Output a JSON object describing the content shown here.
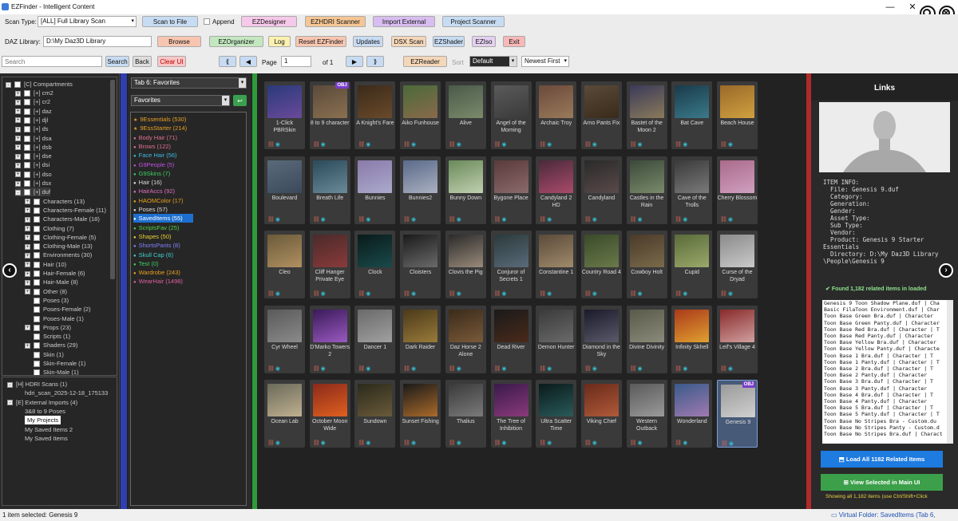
{
  "window": {
    "title": "EZFinder - Intelligent Content",
    "min": "—",
    "close": "✕"
  },
  "toolbar": {
    "scan_type_label": "Scan Type:",
    "scan_type_value": "[ALL] Full Library Scan",
    "scan_to_file": "Scan to File",
    "append": "Append",
    "ezdesigner": "EZDesigner",
    "ezhdri": "EZHDRI Scanner",
    "import_external": "Import External",
    "project_scanner": "Project Scanner",
    "daz_library_label": "DAZ Library:",
    "daz_library_value": "D:\\My Daz3D Library",
    "browse": "Browse",
    "ezorganizer": "EZOrganizer",
    "log": "Log",
    "reset": "Reset EZFinder",
    "updates": "Updates",
    "dsx_scan": "DSX Scan",
    "ezshader": "EZShader",
    "eziso": "EZIso",
    "exit": "Exit",
    "search_placeholder": "Search",
    "search_btn": "Search",
    "back_btn": "Back",
    "clear_ui": "Clear UI",
    "first": "⟪",
    "prev": "◀",
    "page_label": "Page",
    "page_value": "1",
    "of_label": "of 1",
    "next": "▶",
    "last": "⟫",
    "ezreader": "EZReader",
    "sort_label": "Sort",
    "sort_value": "Default",
    "order_value": "Newest First"
  },
  "tree": {
    "root": "[C] Compartments",
    "items": [
      {
        "label": "[+] cm2",
        "level": 1,
        "pm": "+"
      },
      {
        "label": "[+] cr2",
        "level": 1,
        "pm": "+"
      },
      {
        "label": "[+] daz",
        "level": 1,
        "pm": "+"
      },
      {
        "label": "[+] djl",
        "level": 1,
        "pm": "+"
      },
      {
        "label": "[+] ds",
        "level": 1,
        "pm": "+"
      },
      {
        "label": "[+] dsa",
        "level": 1,
        "pm": "+"
      },
      {
        "label": "[+] dsb",
        "level": 1,
        "pm": "+"
      },
      {
        "label": "[+] dse",
        "level": 1,
        "pm": "+"
      },
      {
        "label": "[+] dsi",
        "level": 1,
        "pm": "+"
      },
      {
        "label": "[+] dso",
        "level": 1,
        "pm": "+"
      },
      {
        "label": "[+] dsx",
        "level": 1,
        "pm": "+"
      },
      {
        "label": "[+] duf",
        "level": 1,
        "pm": "-"
      },
      {
        "label": "Characters (13)",
        "level": 2,
        "pm": "+"
      },
      {
        "label": "Characters-Female (11)",
        "level": 2,
        "pm": "+"
      },
      {
        "label": "Characters-Male (18)",
        "level": 2,
        "pm": "+"
      },
      {
        "label": "Clothing (7)",
        "level": 2,
        "pm": "+"
      },
      {
        "label": "Clothing-Female (5)",
        "level": 2,
        "pm": "+"
      },
      {
        "label": "Clothing-Male (13)",
        "level": 2,
        "pm": "+"
      },
      {
        "label": "Environments (30)",
        "level": 2,
        "pm": "+"
      },
      {
        "label": "Hair (10)",
        "level": 2,
        "pm": "+"
      },
      {
        "label": "Hair-Female (6)",
        "level": 2,
        "pm": "+"
      },
      {
        "label": "Hair-Male (8)",
        "level": 2,
        "pm": "+"
      },
      {
        "label": "Other (8)",
        "level": 2,
        "pm": "+"
      },
      {
        "label": "Poses (3)",
        "level": 2,
        "pm": ""
      },
      {
        "label": "Poses-Female (2)",
        "level": 2,
        "pm": ""
      },
      {
        "label": "Poses-Male (1)",
        "level": 2,
        "pm": ""
      },
      {
        "label": "Props (23)",
        "level": 2,
        "pm": "+"
      },
      {
        "label": "Scripts (1)",
        "level": 2,
        "pm": ""
      },
      {
        "label": "Shaders (29)",
        "level": 2,
        "pm": "+"
      },
      {
        "label": "Skin (1)",
        "level": 2,
        "pm": ""
      },
      {
        "label": "Skin-Female (1)",
        "level": 2,
        "pm": ""
      },
      {
        "label": "Skin-Male (1)",
        "level": 2,
        "pm": ""
      }
    ]
  },
  "tree2": {
    "items": [
      {
        "label": "[H] HDRI Scans (1)",
        "level": 0,
        "pm": "-"
      },
      {
        "label": "hdri_scan_2025-12-18_175133",
        "level": 1,
        "pm": ""
      },
      {
        "label": "[E] External Imports (4)",
        "level": 0,
        "pm": "-"
      },
      {
        "label": "3&8 to 9 Poses",
        "level": 1,
        "pm": ""
      },
      {
        "label": "My Projects",
        "level": 1,
        "pm": "",
        "sel": true
      },
      {
        "label": "My Saved Items 2",
        "level": 1,
        "pm": ""
      },
      {
        "label": "My Saved Items",
        "level": 1,
        "pm": ""
      }
    ]
  },
  "favorites": {
    "tab_value": "Tab 6: Favorites",
    "list_value": "Favorites",
    "items": [
      {
        "label": "9Essentials (530)",
        "icon": "★",
        "color": "#e8a020"
      },
      {
        "label": "9EssStarter (214)",
        "icon": "★",
        "color": "#e8a020"
      },
      {
        "label": "Body Hair (71)",
        "icon": "●",
        "color": "#e07090"
      },
      {
        "label": "Brows (122)",
        "icon": "●",
        "color": "#e07090"
      },
      {
        "label": "Face Hair (56)",
        "icon": "●",
        "color": "#40b8e0"
      },
      {
        "label": "G9People (5)",
        "icon": "●",
        "color": "#c050e0"
      },
      {
        "label": "G9Skins (7)",
        "icon": "●",
        "color": "#40d060"
      },
      {
        "label": "Hair (16)",
        "icon": "●",
        "color": "#dddddd"
      },
      {
        "label": "HairAccs (92)",
        "icon": "●",
        "color": "#e070c0"
      },
      {
        "label": "HAOMColor (17)",
        "icon": "●",
        "color": "#e8a020"
      },
      {
        "label": "Poses (57)",
        "icon": "●",
        "color": "#dddddd"
      },
      {
        "label": "SavedItems (55)",
        "icon": "●",
        "color": "#ffffff",
        "sel": true
      },
      {
        "label": "ScriptsFav (25)",
        "icon": "●",
        "color": "#50d040"
      },
      {
        "label": "Shapes (50)",
        "icon": "●",
        "color": "#e8d030"
      },
      {
        "label": "ShortsPants (8)",
        "icon": "●",
        "color": "#8080ff"
      },
      {
        "label": "Skull Cap (6)",
        "icon": "●",
        "color": "#40d0d0"
      },
      {
        "label": "Test (0)",
        "icon": "●",
        "color": "#40d060"
      },
      {
        "label": "Wardrobe (243)",
        "icon": "●",
        "color": "#e8a020"
      },
      {
        "label": "WearHair (1498)",
        "icon": "●",
        "color": "#e060a0"
      }
    ]
  },
  "tiles": [
    {
      "name": "1-Click PBRSkin",
      "c1": "#2a3a7a",
      "c2": "#6a4a9a"
    },
    {
      "name": "8 to 9 character",
      "c1": "#5a4a3a",
      "c2": "#8a7050",
      "obj": true
    },
    {
      "name": "A Knight's Fare",
      "c1": "#3a2a1a",
      "c2": "#6a4a2a"
    },
    {
      "name": "Aiko Funhouse",
      "c1": "#4a6a3a",
      "c2": "#8a6a4a"
    },
    {
      "name": "Alive",
      "c1": "#4a5a4a",
      "c2": "#7a8a6a"
    },
    {
      "name": "Angel of the Morning",
      "c1": "#5a5a5a",
      "c2": "#3a3a3a"
    },
    {
      "name": "Archaic Troy",
      "c1": "#6a4a3a",
      "c2": "#9a7a5a"
    },
    {
      "name": "Arno Pants Fix",
      "c1": "#5a4a3a",
      "c2": "#3a2a1a"
    },
    {
      "name": "Bastet of the Moon 2",
      "c1": "#3a3a5a",
      "c2": "#8a7a5a"
    },
    {
      "name": "Bat Cave",
      "c1": "#1a3a4a",
      "c2": "#3a7a8a"
    },
    {
      "name": "Beach House",
      "c1": "#9a6a2a",
      "c2": "#d0a040"
    },
    {
      "name": "Boulevard",
      "c1": "#5a6a7a",
      "c2": "#3a4a5a"
    },
    {
      "name": "Breath Life",
      "c1": "#2a4a5a",
      "c2": "#6a8a9a"
    },
    {
      "name": "Bunnies",
      "c1": "#8a7aaa",
      "c2": "#aaaacc"
    },
    {
      "name": "Bunnies2",
      "c1": "#5a6a8a",
      "c2": "#aab0c0"
    },
    {
      "name": "Bunny Down",
      "c1": "#6a8a5a",
      "c2": "#c0d0b0"
    },
    {
      "name": "Bygone Place",
      "c1": "#5a3a3a",
      "c2": "#8a6a6a"
    },
    {
      "name": "Candyland 2 HD",
      "c1": "#4a2a3a",
      "c2": "#aa4a6a"
    },
    {
      "name": "Candyland",
      "c1": "#2a2a2a",
      "c2": "#5a4a4a"
    },
    {
      "name": "Castles in the Rain",
      "c1": "#3a4a3a",
      "c2": "#7a8a6a"
    },
    {
      "name": "Cave of the Trolls",
      "c1": "#3a3a3a",
      "c2": "#7a7a7a"
    },
    {
      "name": "Cherry Blossom",
      "c1": "#aa6a8a",
      "c2": "#d0a0c0"
    },
    {
      "name": "Cleo",
      "c1": "#6a5a3a",
      "c2": "#b09060"
    },
    {
      "name": "Cliff Hanger Private Eye",
      "c1": "#4a2a2a",
      "c2": "#8a3a3a"
    },
    {
      "name": "Clock",
      "c1": "#0a1a1a",
      "c2": "#1a4a4a"
    },
    {
      "name": "Cloisters",
      "c1": "#1a1a1a",
      "c2": "#6a6a6a"
    },
    {
      "name": "Clovis the Pig",
      "c1": "#2a2a2a",
      "c2": "#9a8a7a"
    },
    {
      "name": "Conjuror of Secrets 1",
      "c1": "#2a3a3a",
      "c2": "#5a6a7a"
    },
    {
      "name": "Constantine 1",
      "c1": "#5a4a3a",
      "c2": "#a08a6a"
    },
    {
      "name": "Country Road 4",
      "c1": "#3a4a2a",
      "c2": "#6a7a4a"
    },
    {
      "name": "Cowboy Holt",
      "c1": "#4a3a2a",
      "c2": "#7a6a4a"
    },
    {
      "name": "Cupid",
      "c1": "#5a6a3a",
      "c2": "#9aaa6a"
    },
    {
      "name": "Curse of the Dryad",
      "c1": "#8a8a8a",
      "c2": "#cacaca"
    },
    {
      "name": "Cyr Wheel",
      "c1": "#5a5a5a",
      "c2": "#8a8a8a"
    },
    {
      "name": "D'Marko Towers 2",
      "c1": "#3a1a5a",
      "c2": "#9a5ac0"
    },
    {
      "name": "Dancer 1",
      "c1": "#6a6a6a",
      "c2": "#a0a0a0"
    },
    {
      "name": "Dark Raider",
      "c1": "#4a3a1a",
      "c2": "#9a7a3a"
    },
    {
      "name": "Daz Horse 2 Alone",
      "c1": "#3a2a1a",
      "c2": "#7a5a3a"
    },
    {
      "name": "Dead River",
      "c1": "#1a1a1a",
      "c2": "#4a2a1a"
    },
    {
      "name": "Demon Hunter",
      "c1": "#3a3a3a",
      "c2": "#6a6a6a"
    },
    {
      "name": "Diamond in the Sky",
      "c1": "#1a1a2a",
      "c2": "#5a5a6a"
    },
    {
      "name": "Divine Divinity",
      "c1": "#5a5a4a",
      "c2": "#8a8a7a"
    },
    {
      "name": "Infinity Skhell",
      "c1": "#aa3a1a",
      "c2": "#e0a030"
    },
    {
      "name": "Leif's Village 4",
      "c1": "#8a2a2a",
      "c2": "#d0a0a0"
    },
    {
      "name": "Ocean Lab",
      "c1": "#6a6a5a",
      "c2": "#c0b090"
    },
    {
      "name": "October Moon Wide",
      "c1": "#8a2a1a",
      "c2": "#e06020"
    },
    {
      "name": "Sundown",
      "c1": "#2a2a1a",
      "c2": "#6a5a3a"
    },
    {
      "name": "Sunset Fishing",
      "c1": "#1a1a1a",
      "c2": "#aa6a2a"
    },
    {
      "name": "Thalius",
      "c1": "#3a3a3a",
      "c2": "#7a7a7a"
    },
    {
      "name": "The Tree of Inhibition",
      "c1": "#3a1a4a",
      "c2": "#8a3a7a"
    },
    {
      "name": "Ultra Scatter Time",
      "c1": "#0a1a1a",
      "c2": "#2a5a5a"
    },
    {
      "name": "Viking Chief",
      "c1": "#6a2a1a",
      "c2": "#b05a3a"
    },
    {
      "name": "Western Outback",
      "c1": "#5a5a5a",
      "c2": "#9a9a9a"
    },
    {
      "name": "Wonderland",
      "c1": "#3a5a8a",
      "c2": "#a07ab0"
    },
    {
      "name": "Genesis 9",
      "c1": "#9a9a9a",
      "c2": "#d0d0d0",
      "obj": true,
      "sel": true
    }
  ],
  "links": {
    "title": "Links",
    "info": [
      "ITEM INFO:",
      "  File: Genesis 9.duf",
      "  Category:",
      "  Generation:",
      "  Gender:",
      "  Asset Type:",
      "  Sub Type:",
      "  Vendor:",
      "  Product: Genesis 9 Starter",
      "Essentials",
      "  Directory: D:\\My Daz3D Library",
      "\\People\\Genesis 9"
    ],
    "found": "Found 1,182 related items in loaded",
    "related": [
      "Genesis 9 Toon Shadow Plane.duf | Cha",
      "Basic FilaToon Environment.duf | Char",
      "Toon Base Green Bra.duf | Character",
      "Toon Base Green Panty.duf | Character",
      "Toon Base Red Bra.duf | Character | T",
      "Toon Base Red Panty.duf | Character",
      "Toon Base Yellow Bra.duf | Character",
      "Toon Base Yellow Panty.duf | Characte",
      "Toon Base 1 Bra.duf | Character | T",
      "Toon Base 1 Panty.duf | Character | T",
      "Toon Base 2 Bra.duf | Character | T",
      "Toon Base 2 Panty.duf | Character",
      "Toon Base 3 Bra.duf | Character | T",
      "Toon Base 3 Panty.duf | Character",
      "Toon Base 4 Bra.duf | Character | T",
      "Toon Base 4 Panty.duf | Character",
      "Toon Base 5 Bra.duf | Character | T",
      "Toon Base 5 Panty.duf | Character | T",
      "Toon Base No Stripes Bra - Custom.du",
      "Toon Base No Stripes Panty - Custom.d",
      "Toon Base No Stripes Bra.duf | Charact"
    ],
    "load_all": "Load All 1182 Related Items",
    "view_selected": "View Selected in Main UI",
    "showing": "Showing all 1,182 items (use Ctrl/Shift+Click"
  },
  "status": {
    "left": "1 item selected: Genesis 9",
    "right": "Virtual Folder: SavedItems (Tab 6, Favorites)"
  },
  "icons": {
    "search": "search-icon",
    "close": "close-icon",
    "nav_left": "‹",
    "nav_right": "›"
  }
}
